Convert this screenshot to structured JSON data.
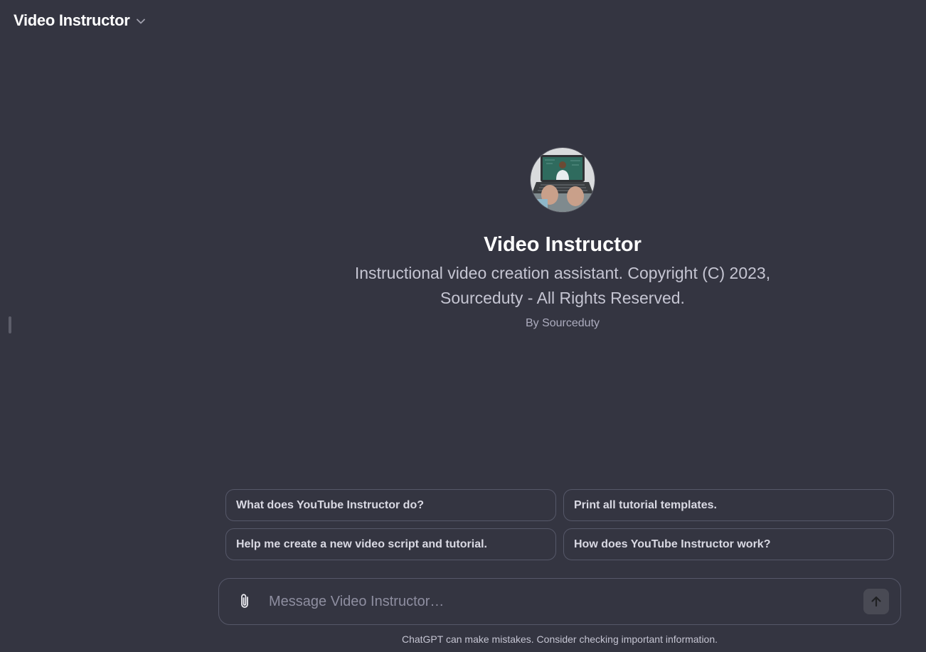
{
  "header": {
    "title": "Video Instructor",
    "dropdown_icon": "chevron-down-icon"
  },
  "hero": {
    "name": "Video Instructor",
    "description": "Instructional video creation assistant. Copyright (C) 2023, Sourceduty - All Rights Reserved.",
    "byline": "By Sourceduty",
    "avatar_icon": "gpt-avatar"
  },
  "suggestions": [
    "What does YouTube Instructor do?",
    "Print all tutorial templates.",
    "Help me create a new video script and tutorial.",
    "How does YouTube Instructor work?"
  ],
  "composer": {
    "placeholder": "Message Video Instructor…",
    "attach_icon": "paperclip-icon",
    "send_icon": "arrow-up-icon"
  },
  "footer": {
    "disclaimer": "ChatGPT can make mistakes. Consider checking important information."
  },
  "colors": {
    "background": "#343541",
    "border": "#565869",
    "text": "#ececf1",
    "muted": "#acacbe"
  }
}
